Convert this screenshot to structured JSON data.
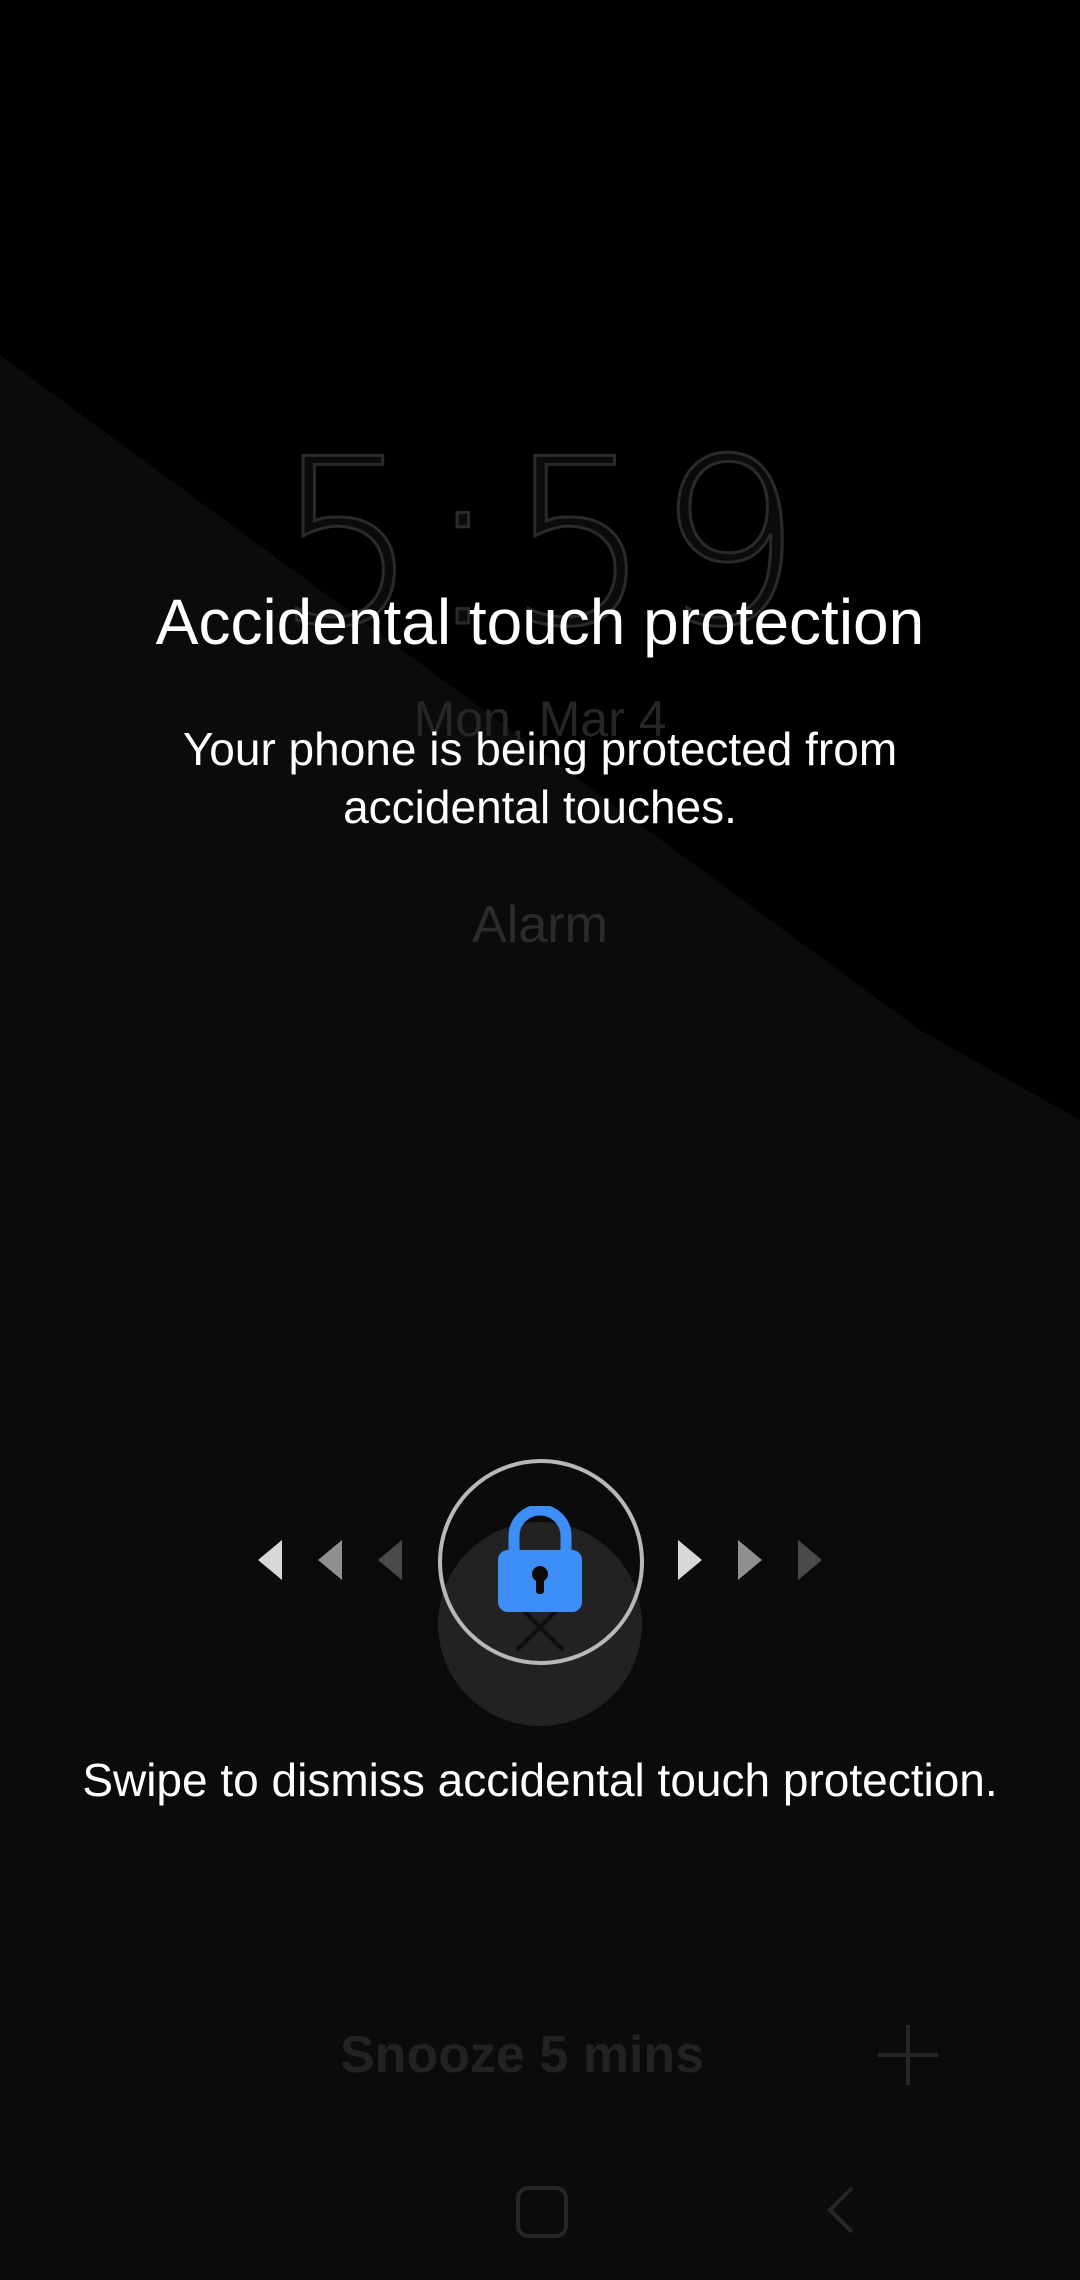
{
  "alarm": {
    "time": "5:59",
    "date": "Mon, Mar 4",
    "label": "Alarm",
    "snooze_label": "Snooze 5 mins"
  },
  "overlay": {
    "title": "Accidental touch protection",
    "description": "Your phone is being protected from accidental touches.",
    "swipe_hint": "Swipe to dismiss accidental touch protection."
  },
  "icons": {
    "lock": "lock-icon",
    "dismiss": "close-icon",
    "add": "plus-icon",
    "home": "home-icon",
    "back": "back-icon",
    "left_arrows": "chevron-left-icon",
    "right_arrows": "chevron-right-icon"
  },
  "colors": {
    "background": "#000000",
    "background_band": "#0b0b0b",
    "accent": "#3d8ef7",
    "text": "#ffffff",
    "ring": "#b8b8b8"
  }
}
